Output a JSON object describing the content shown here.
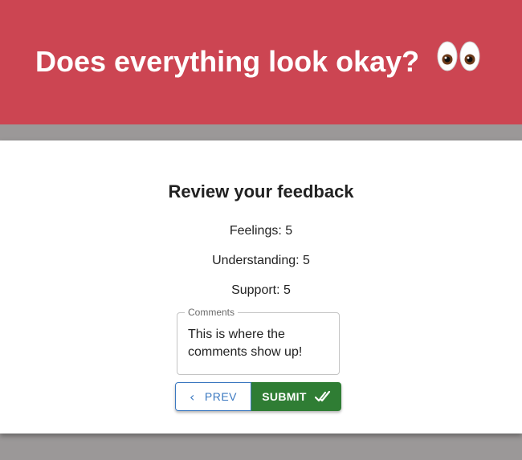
{
  "header": {
    "title": "Does everything look okay?",
    "emoji_icon": "eyes-emoji",
    "background": "#cc4552"
  },
  "review": {
    "title": "Review your feedback",
    "feelings": "Feelings: 5",
    "understanding": "Understanding: 5",
    "support": "Support: 5"
  },
  "comments": {
    "label": "Comments",
    "value": "This is where the comments show up!"
  },
  "buttons": {
    "prev_label": "PREV",
    "prev_icon": "chevron-left-icon",
    "submit_label": "SUBMIT",
    "submit_icon": "double-check-icon",
    "prev_color": "#3a78c0",
    "submit_color": "#2f7d34"
  }
}
